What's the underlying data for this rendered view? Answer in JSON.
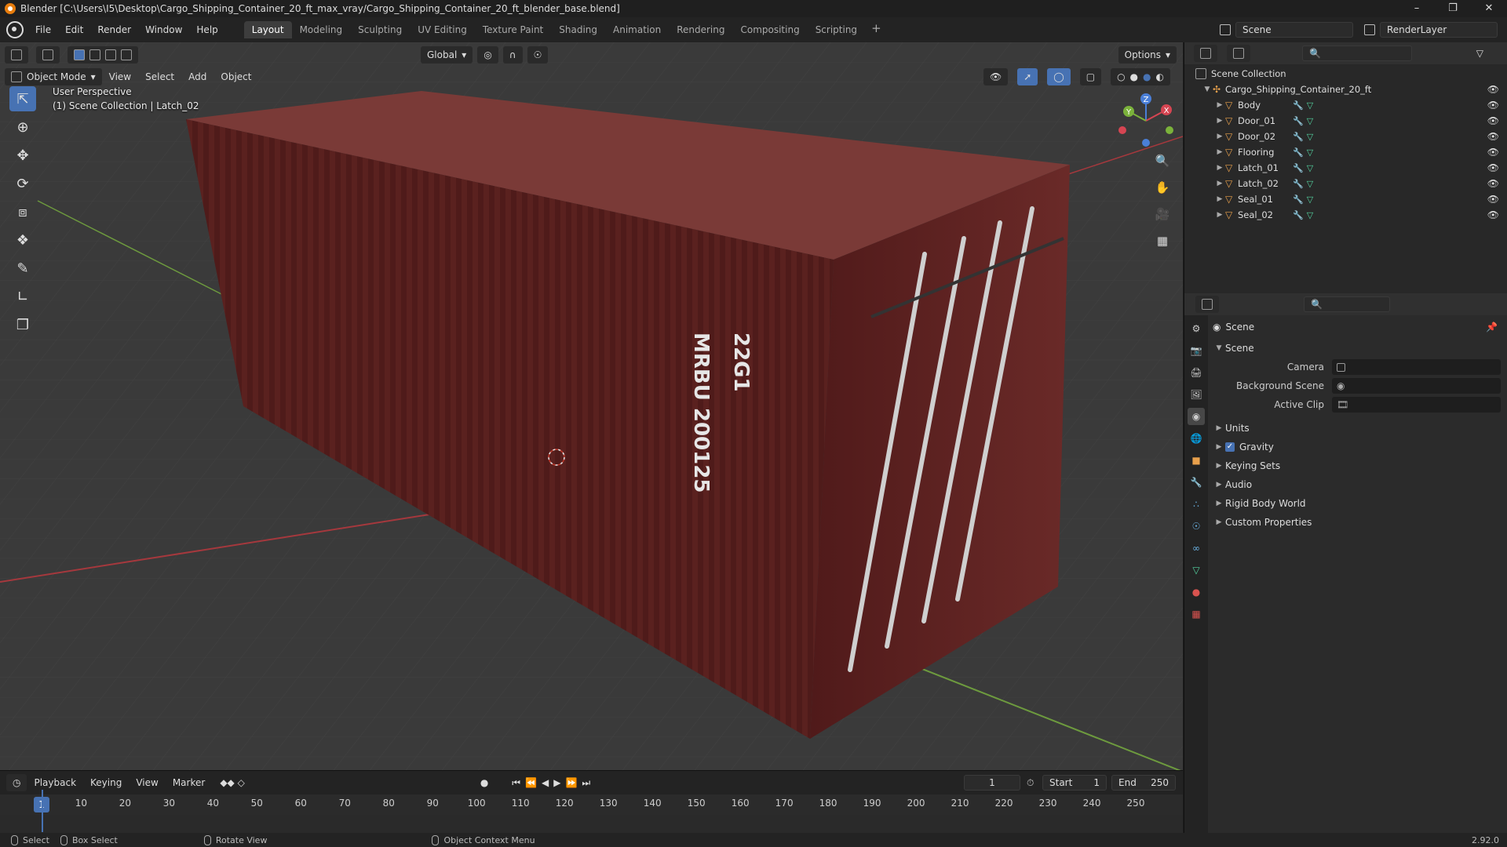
{
  "window": {
    "title": "Blender [C:\\Users\\I5\\Desktop\\Cargo_Shipping_Container_20_ft_max_vray/Cargo_Shipping_Container_20_ft_blender_base.blend]",
    "controls": [
      "–",
      "❐",
      "✕"
    ]
  },
  "menu": {
    "items": [
      "File",
      "Edit",
      "Render",
      "Window",
      "Help"
    ]
  },
  "workspaces": {
    "active": "Layout",
    "tabs": [
      "Layout",
      "Modeling",
      "Sculpting",
      "UV Editing",
      "Texture Paint",
      "Shading",
      "Animation",
      "Rendering",
      "Compositing",
      "Scripting"
    ],
    "add": "+"
  },
  "scene_selector": {
    "value": "Scene"
  },
  "view_layer_selector": {
    "value": "RenderLayer"
  },
  "viewport": {
    "mode": "Object Mode",
    "menus": [
      "View",
      "Select",
      "Add",
      "Object"
    ],
    "transform_orientation": "Global",
    "options_label": "Options",
    "overlay_line1": "User Perspective",
    "overlay_line2": "(1) Scene Collection | Latch_02",
    "container_text_vertical": "MRBU 200125",
    "container_text_code": "22G1",
    "gizmo": {
      "x": "X",
      "y": "Y",
      "z": "Z"
    }
  },
  "timeline": {
    "menus": [
      "Playback",
      "Keying",
      "View",
      "Marker"
    ],
    "current_frame": "1",
    "start_label": "Start",
    "start_value": "1",
    "end_label": "End",
    "end_value": "250",
    "ruler_ticks": [
      "1",
      "10",
      "20",
      "30",
      "40",
      "50",
      "60",
      "70",
      "80",
      "90",
      "100",
      "110",
      "120",
      "130",
      "140",
      "150",
      "160",
      "170",
      "180",
      "190",
      "200",
      "210",
      "220",
      "230",
      "240",
      "250"
    ]
  },
  "status": {
    "select": "Select",
    "box_select": "Box Select",
    "rotate_view": "Rotate View",
    "context_menu": "Object Context Menu",
    "version": "2.92.0"
  },
  "outliner": {
    "root": "Scene Collection",
    "collection": "Cargo_Shipping_Container_20_ft",
    "objects": [
      "Body",
      "Door_01",
      "Door_02",
      "Flooring",
      "Latch_01",
      "Latch_02",
      "Seal_01",
      "Seal_02"
    ]
  },
  "properties": {
    "context": "Scene",
    "panel_title": "Scene",
    "camera_label": "Camera",
    "background_scene_label": "Background Scene",
    "active_clip_label": "Active Clip",
    "subpanels": [
      "Units",
      "Gravity",
      "Keying Sets",
      "Audio",
      "Rigid Body World",
      "Custom Properties"
    ],
    "gravity_checked": true
  },
  "colors": {
    "container": "#6e2a28",
    "accent": "#4772b3",
    "viewport_bg": "#393939"
  }
}
